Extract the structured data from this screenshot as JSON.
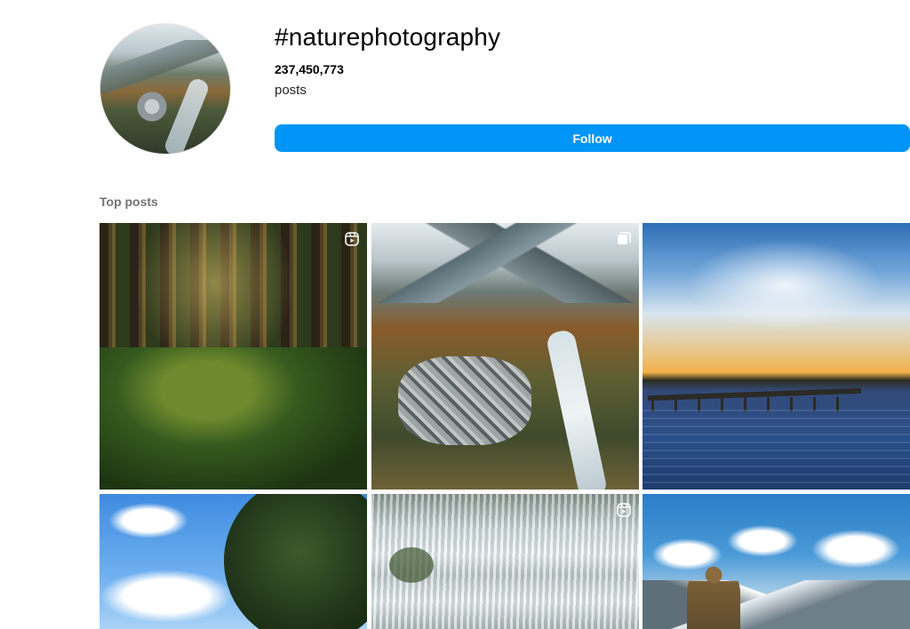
{
  "header": {
    "hashtag": "#naturephotography",
    "post_count": "237,450,773",
    "post_count_label": "posts",
    "follow_label": "Follow"
  },
  "colors": {
    "follow_button": "#0095f6",
    "section_label": "#737373"
  },
  "section": {
    "top_posts_label": "Top posts"
  },
  "posts": [
    {
      "subject": "forest",
      "badge_icon": "reel-icon"
    },
    {
      "subject": "alpine-village",
      "badge_icon": "carousel-icon"
    },
    {
      "subject": "lake-sunset",
      "badge_icon": ""
    },
    {
      "subject": "sky-tree",
      "badge_icon": ""
    },
    {
      "subject": "waterfall",
      "badge_icon": "reel-icon"
    },
    {
      "subject": "hiker-mountains",
      "badge_icon": ""
    }
  ]
}
